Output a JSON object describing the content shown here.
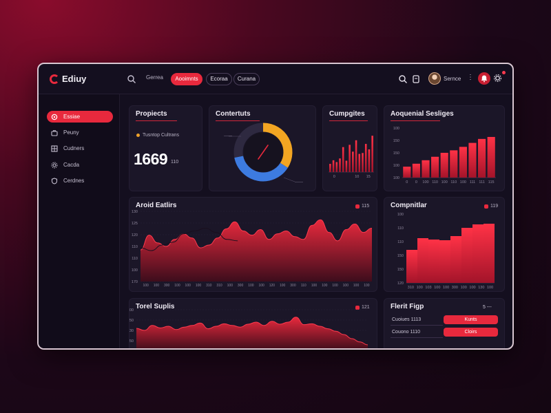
{
  "app": {
    "name": "Ediuy"
  },
  "topbar": {
    "nav_plain": "Gerrea",
    "pills": [
      {
        "label": "Aooimnts",
        "active": true
      },
      {
        "label": "Ecoraa",
        "active": false
      },
      {
        "label": "Curana",
        "active": false
      }
    ],
    "user_name": "Sernce",
    "more": "⋮"
  },
  "sidebar": {
    "items": [
      {
        "label": "Essiae",
        "icon": "dashboard-icon",
        "active": true
      },
      {
        "label": "Peuny",
        "icon": "briefcase-icon",
        "active": false
      },
      {
        "label": "Cudners",
        "icon": "grid-icon",
        "active": false
      },
      {
        "label": "Cacda",
        "icon": "gear-icon",
        "active": false
      },
      {
        "label": "Cerdnes",
        "icon": "shield-icon",
        "active": false
      }
    ]
  },
  "cards": {
    "projects": {
      "title": "Propiects",
      "subtitle": "Tusntop Cultrans",
      "value": "1669",
      "unit": "110"
    },
    "contents": {
      "title": "Contertuts",
      "left_label": "------",
      "right_label": "------"
    },
    "campaigns": {
      "title": "Cumpgites"
    },
    "sessions": {
      "title": "Aoquenial Sesliges"
    },
    "activity": {
      "title": "Aroid Eatlirs",
      "legend": "115"
    },
    "compare": {
      "title": "Compnitlar",
      "legend": "119"
    },
    "traffic": {
      "title": "Torel Suplis",
      "legend": "121"
    },
    "fleet": {
      "title": "Flerit Figp",
      "title_value": "5 ---",
      "rows": [
        {
          "label": "Cuoiues 1113",
          "button": "Kunts"
        },
        {
          "label": "Couono 1110",
          "button": "Cloirs"
        }
      ]
    }
  },
  "colors": {
    "accent": "#e8293d",
    "gauge_blue": "#3d7be0",
    "gauge_amber": "#f2a522",
    "panel": "#1b1628"
  },
  "chart_data": [
    {
      "type": "bar",
      "name": "campaigns",
      "title": "Cumpgites",
      "values": [
        18,
        26,
        22,
        30,
        55,
        25,
        60,
        45,
        70,
        40,
        42,
        62,
        50,
        80
      ],
      "ylim": [
        0,
        100
      ],
      "xticks": [
        "0",
        "",
        "10",
        "15"
      ]
    },
    {
      "type": "bar",
      "name": "sessions",
      "title": "Aoquenial Sesliges",
      "categories": [
        "0",
        "0",
        "100",
        "110",
        "100",
        "110",
        "100",
        "111",
        "111",
        "115"
      ],
      "values": [
        22,
        28,
        35,
        42,
        50,
        55,
        62,
        70,
        78,
        82
      ],
      "yticks": [
        "100",
        "100",
        "150",
        "150",
        "100"
      ],
      "ylim": [
        0,
        100
      ]
    },
    {
      "type": "area",
      "name": "activity",
      "title": "Aroid Eatlirs",
      "values": [
        45,
        66,
        55,
        50,
        60,
        68,
        62,
        48,
        52,
        62,
        75,
        85,
        72,
        66,
        74,
        60,
        68,
        72,
        64,
        60,
        80,
        88,
        70,
        58,
        74,
        82,
        70,
        76
      ],
      "overlay": [
        48,
        44,
        52,
        56,
        68,
        72,
        76,
        70,
        60,
        58
      ],
      "ylim": [
        0,
        100
      ],
      "yticks": [
        "130",
        "125",
        "120",
        "110",
        "110",
        "100",
        "170"
      ],
      "xticks": [
        "100",
        "100",
        "300",
        "100",
        "100",
        "100",
        "310",
        "310",
        "100",
        "300",
        "100",
        "100",
        "120",
        "100",
        "300",
        "110",
        "100",
        "100",
        "100",
        "100",
        "100",
        "100"
      ]
    },
    {
      "type": "bar",
      "name": "compare",
      "title": "Compnitlar",
      "values": [
        48,
        65,
        63,
        62,
        68,
        80,
        85,
        86
      ],
      "ylim": [
        0,
        100
      ],
      "yticks": [
        "120",
        "150",
        "150",
        "110",
        "110",
        "100"
      ],
      "xticks": [
        "310",
        "100",
        "103",
        "100",
        "100",
        "300",
        "100",
        "100",
        "130",
        "100"
      ]
    },
    {
      "type": "area",
      "name": "traffic",
      "title": "Torel Suplis",
      "values": [
        55,
        50,
        62,
        56,
        60,
        52,
        58,
        62,
        68,
        54,
        60,
        66,
        62,
        58,
        65,
        70,
        62,
        72,
        65,
        70,
        82,
        64,
        66,
        60,
        54,
        48,
        40,
        30,
        22,
        15
      ],
      "ylim": [
        0,
        100
      ],
      "yticks": [
        "100",
        "150",
        "130",
        "150",
        "110"
      ]
    },
    {
      "type": "pie",
      "name": "contents",
      "title": "Contertuts",
      "slices": [
        {
          "value": 34,
          "color": "#f2a522"
        },
        {
          "value": 38,
          "color": "#3d7be0"
        },
        {
          "value": 28,
          "color": "#2e2940"
        }
      ]
    }
  ]
}
